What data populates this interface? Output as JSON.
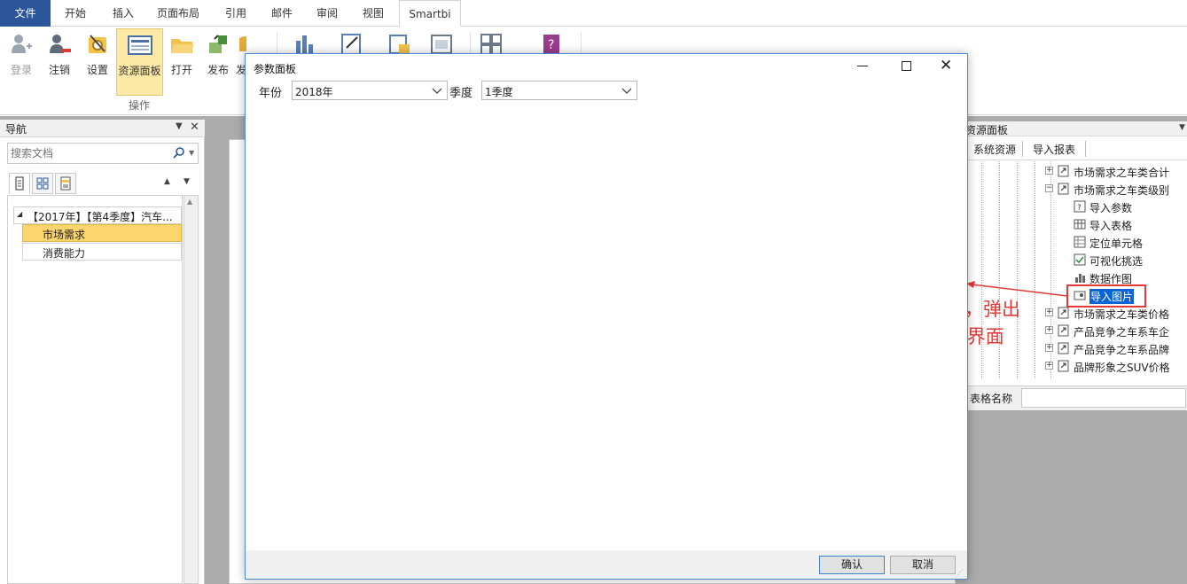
{
  "ribbon_tabs": [
    "文件",
    "开始",
    "插入",
    "页面布局",
    "引用",
    "邮件",
    "审阅",
    "视图",
    "Smartbi"
  ],
  "ribbon": {
    "buttons": [
      "登录",
      "注销",
      "设置",
      "资源面板",
      "打开",
      "发布",
      "发"
    ],
    "group_label": "操作"
  },
  "nav": {
    "title": "导航",
    "search_placeholder": "搜索文档",
    "tree": {
      "root": "【2017年】【第4季度】汽车...",
      "items": [
        "市场需求",
        "消费能力"
      ]
    }
  },
  "resource_panel": {
    "title": "资源面板",
    "tabs": [
      "系统资源",
      "导入报表"
    ],
    "tree": [
      "市场需求之车类合计",
      "市场需求之车类级别",
      "导入参数",
      "导入表格",
      "定位单元格",
      "可视化挑选",
      "数据作图",
      "导入图片",
      "市场需求之车类价格",
      "产品竞争之车系车企",
      "产品竞争之车系品牌",
      "品牌形象之SUV价格"
    ],
    "footer_label": "表格名称"
  },
  "dialog": {
    "title": "参数面板",
    "fields": [
      {
        "label": "年份",
        "value": "2018年"
      },
      {
        "label": "季度",
        "value": "1季度"
      }
    ],
    "buttons": {
      "ok": "确认",
      "cancel": "取消"
    }
  },
  "annotation": {
    "line1": "双击导入图片，弹出",
    "line2": "“参数面板”界面",
    "color": "#e53935"
  },
  "colors": {
    "file_tab": "#2b579a",
    "selected_ribbon": "#fde9a6",
    "selected_tree": "#fcd56d",
    "highlight": "#0a64d8"
  }
}
